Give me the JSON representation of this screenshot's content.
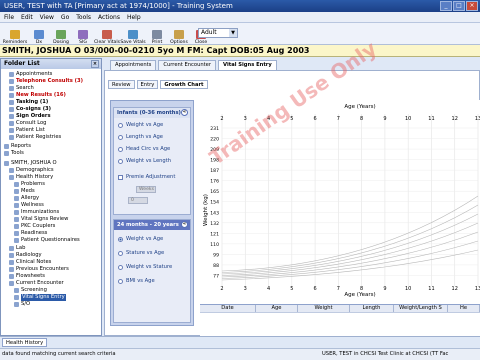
{
  "window": {
    "title": "USER, TEST with TA [Primary act at 1974/1000] - Training System"
  },
  "menu": [
    "File",
    "Edit",
    "View",
    "Go",
    "Tools",
    "Actions",
    "Help"
  ],
  "toolbar": {
    "buttons": [
      {
        "label": "Reminders",
        "color": "#d9a62e"
      },
      {
        "label": "Dx",
        "color": "#5b8bd0"
      },
      {
        "label": "Dosing",
        "color": "#6aa55c"
      },
      {
        "label": "SIG",
        "color": "#8e6dbd"
      },
      {
        "label": "Clear Vitals",
        "color": "#c85c4c"
      },
      {
        "label": "Save Vitals",
        "color": "#4c8fc8"
      },
      {
        "label": "Print",
        "color": "#7d8aa0"
      },
      {
        "label": "Options",
        "color": "#c8a04c"
      },
      {
        "label": "Close",
        "color": "#c84c4c"
      }
    ],
    "dropdown_value": "Adult"
  },
  "patient_banner": "SMITH, JOSHUA O  03/000-00-0210  5yo  M   FM: Capt  DOB:05 Aug 2003",
  "folder_list": {
    "title": "Folder List",
    "items": [
      {
        "label": "Appointments",
        "indent": 2,
        "style": "normal"
      },
      {
        "label": "Telephone Consults (3)",
        "indent": 2,
        "style": "red"
      },
      {
        "label": "Search",
        "indent": 2,
        "style": "normal"
      },
      {
        "label": "New Results (16)",
        "indent": 2,
        "style": "red"
      },
      {
        "label": "Tasking (1)",
        "indent": 2,
        "style": "bold"
      },
      {
        "label": "Co-signs (3)",
        "indent": 2,
        "style": "bold"
      },
      {
        "label": "Sign Orders",
        "indent": 2,
        "style": "bold"
      },
      {
        "label": "Consult Log",
        "indent": 2,
        "style": "normal"
      },
      {
        "label": "Patient List",
        "indent": 2,
        "style": "normal"
      },
      {
        "label": "Patient Registries",
        "indent": 2,
        "style": "normal"
      },
      {
        "label": "Reports",
        "indent": 1,
        "style": "normal"
      },
      {
        "label": "Tools",
        "indent": 1,
        "style": "normal"
      },
      {
        "label": "SMITH, JOSHUA O",
        "indent": 1,
        "style": "normal"
      },
      {
        "label": "Demographics",
        "indent": 2,
        "style": "normal"
      },
      {
        "label": "Health History",
        "indent": 2,
        "style": "normal"
      },
      {
        "label": "Problems",
        "indent": 3,
        "style": "normal"
      },
      {
        "label": "Meds",
        "indent": 3,
        "style": "normal"
      },
      {
        "label": "Allergy",
        "indent": 3,
        "style": "normal"
      },
      {
        "label": "Wellness",
        "indent": 3,
        "style": "normal"
      },
      {
        "label": "Immunizations",
        "indent": 3,
        "style": "normal"
      },
      {
        "label": "Vital Signs Review",
        "indent": 3,
        "style": "normal"
      },
      {
        "label": "PKC Couplers",
        "indent": 3,
        "style": "normal"
      },
      {
        "label": "Readiness",
        "indent": 3,
        "style": "normal"
      },
      {
        "label": "Patient Questionnaires",
        "indent": 3,
        "style": "normal"
      },
      {
        "label": "Lab",
        "indent": 2,
        "style": "normal"
      },
      {
        "label": "Radiology",
        "indent": 2,
        "style": "normal"
      },
      {
        "label": "Clinical Notes",
        "indent": 2,
        "style": "normal"
      },
      {
        "label": "Previous Encounters",
        "indent": 2,
        "style": "normal"
      },
      {
        "label": "Flowsheets",
        "indent": 2,
        "style": "normal"
      },
      {
        "label": "Current Encounter",
        "indent": 2,
        "style": "normal"
      },
      {
        "label": "Screening",
        "indent": 3,
        "style": "normal"
      },
      {
        "label": "Vital Signs Entry",
        "indent": 3,
        "style": "selected"
      },
      {
        "label": "S/O",
        "indent": 3,
        "style": "normal"
      }
    ]
  },
  "tabs": [
    "Appointments",
    "Current Encounter",
    "Vital Signs Entry"
  ],
  "subtabs": [
    "Review",
    "Entry",
    "Growth Chart"
  ],
  "infants": {
    "title": "Infants (0-36 months)",
    "options": [
      "Weight vs Age",
      "Length vs Age",
      "Head Circ vs Age",
      "Weight vs Length"
    ],
    "premie_label": "Premie Adjustment",
    "fields": [
      "Weeks",
      "0"
    ]
  },
  "older": {
    "title": "24 months - 20 years",
    "options": [
      "Weight vs Age",
      "Stature vs Age",
      "Weight vs Stature",
      "BMI vs Age"
    ],
    "selected_index": 0
  },
  "chart": {
    "top_axis_label": "Age (Years)",
    "bottom_axis_label": "Age (Years)",
    "ylabel": "Weight (kg)",
    "x_ticks": [
      "2",
      "3",
      "4",
      "5",
      "6",
      "7",
      "8",
      "9",
      "10",
      "11",
      "12",
      "13"
    ],
    "y_ticks": [
      "231",
      "220",
      "209",
      "198",
      "187",
      "176",
      "165",
      "154",
      "143",
      "132",
      "121",
      "110",
      "99",
      "88",
      "77"
    ]
  },
  "watermark": "Training Use Only",
  "grid_headers": [
    "Date",
    "Age",
    "Weight",
    "Length",
    "Weight/Length S",
    "He"
  ],
  "bottom_tab": "Health History",
  "status": {
    "left": "data found matching current search criteria",
    "right": "USER, TEST in CHCSI Test Clinic at CHCSI (TT Fac"
  },
  "colors": {
    "titlebar": "#1b3f86",
    "banner_bg": "#fbf6c9",
    "accent": "#2b5aa8",
    "alert_red": "#c00000",
    "panel_blue": "#c8d3ec"
  }
}
